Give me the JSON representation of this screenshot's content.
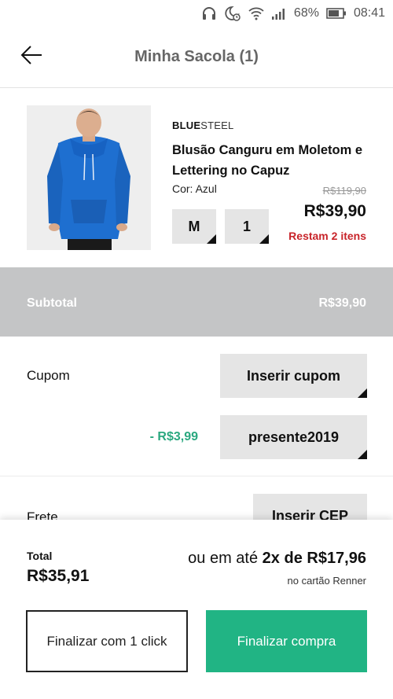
{
  "status_bar": {
    "battery": "68%",
    "time": "08:41",
    "icons": [
      "headphones-icon",
      "do-not-disturb-alarm-icon",
      "wifi-icon",
      "signal-icon",
      "battery-icon"
    ]
  },
  "header": {
    "title": "Minha Sacola (1)",
    "back_icon": "arrow-left-icon"
  },
  "product": {
    "brand_bold": "BLUE",
    "brand_light": "STEEL",
    "name": "Blusão Canguru em Moletom e Lettering no Capuz",
    "color": "Cor: Azul",
    "old_price": "R$119,90",
    "price": "R$39,90",
    "stock_note": "Restam 2 itens",
    "size": "M",
    "quantity": "1"
  },
  "subtotal": {
    "label": "Subtotal",
    "value": "R$39,90"
  },
  "coupon": {
    "label": "Cupom",
    "button": "Inserir cupom",
    "discount": "- R$3,99",
    "code": "presente2019"
  },
  "shipping": {
    "label": "Frete",
    "button": "Inserir CEP"
  },
  "summary": {
    "total_label": "Total",
    "total_value": "R$35,91",
    "installments_prefix": "ou em até",
    "installments_value": "2x de R$17,96",
    "installments_note": "no cartão Renner"
  },
  "actions": {
    "one_click": "Finalizar com 1 click",
    "checkout": "Finalizar compra"
  },
  "colors": {
    "accent_green": "#21b484",
    "discount_green": "#2aa87f",
    "alert_red": "#c8242a",
    "subtotal_bg": "#c4c5c6",
    "button_grey": "#e5e5e5"
  }
}
